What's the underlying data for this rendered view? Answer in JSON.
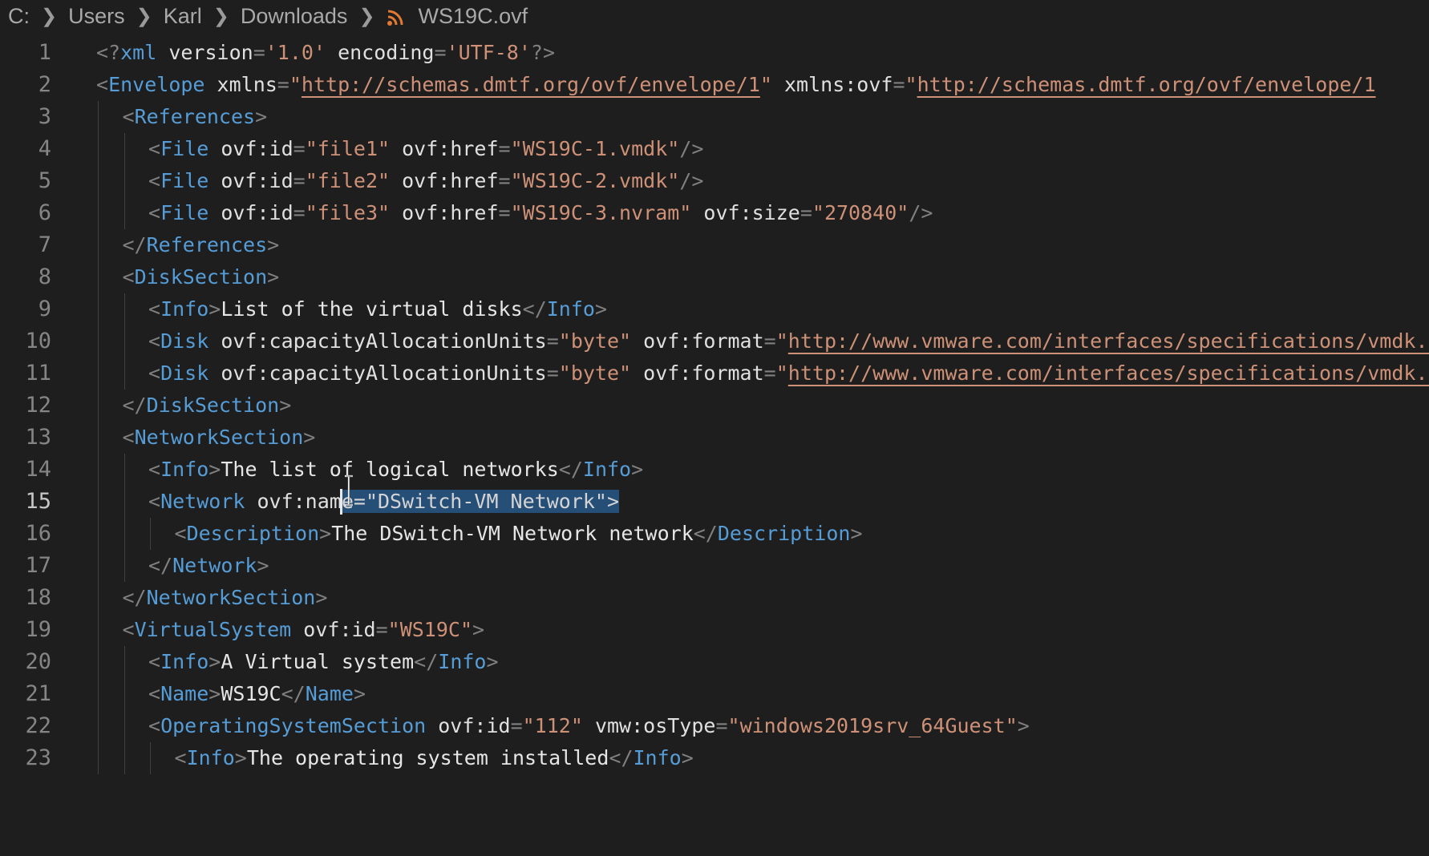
{
  "breadcrumb": {
    "items": [
      "C:",
      "Users",
      "Karl",
      "Downloads"
    ],
    "file": "WS19C.ovf",
    "file_icon": "rss-icon"
  },
  "editor": {
    "active_line": 15,
    "colors": {
      "background": "#1e1e1e",
      "tag": "#569cd6",
      "string": "#ce9178",
      "punctuation": "#808080",
      "selection": "#264f78"
    },
    "lines": [
      {
        "n": "1",
        "indent": 0,
        "tokens": [
          [
            "p",
            "<?"
          ],
          [
            "t",
            "xml"
          ],
          [
            "attr",
            " version"
          ],
          [
            "p",
            "="
          ],
          [
            "s",
            "'1.0'"
          ],
          [
            "attr",
            " encoding"
          ],
          [
            "p",
            "="
          ],
          [
            "s",
            "'UTF-8'"
          ],
          [
            "p",
            "?>"
          ]
        ]
      },
      {
        "n": "2",
        "indent": 0,
        "tokens": [
          [
            "p",
            "<"
          ],
          [
            "t",
            "Envelope"
          ],
          [
            "attr",
            " xmlns"
          ],
          [
            "p",
            "="
          ],
          [
            "s",
            "\""
          ],
          [
            "u",
            "http://schemas.dmtf.org/ovf/envelope/1"
          ],
          [
            "s",
            "\""
          ],
          [
            "attr",
            " xmlns:ovf"
          ],
          [
            "p",
            "="
          ],
          [
            "s",
            "\""
          ],
          [
            "u",
            "http://schemas.dmtf.org/ovf/envelope/1"
          ]
        ]
      },
      {
        "n": "3",
        "indent": 1,
        "tokens": [
          [
            "p",
            "<"
          ],
          [
            "t",
            "References"
          ],
          [
            "p",
            ">"
          ]
        ]
      },
      {
        "n": "4",
        "indent": 2,
        "tokens": [
          [
            "p",
            "<"
          ],
          [
            "t",
            "File"
          ],
          [
            "attr",
            " ovf:id"
          ],
          [
            "p",
            "="
          ],
          [
            "s",
            "\"file1\""
          ],
          [
            "attr",
            " ovf:href"
          ],
          [
            "p",
            "="
          ],
          [
            "s",
            "\"WS19C-1.vmdk\""
          ],
          [
            "p",
            "/>"
          ]
        ]
      },
      {
        "n": "5",
        "indent": 2,
        "tokens": [
          [
            "p",
            "<"
          ],
          [
            "t",
            "File"
          ],
          [
            "attr",
            " ovf:id"
          ],
          [
            "p",
            "="
          ],
          [
            "s",
            "\"file2\""
          ],
          [
            "attr",
            " ovf:href"
          ],
          [
            "p",
            "="
          ],
          [
            "s",
            "\"WS19C-2.vmdk\""
          ],
          [
            "p",
            "/>"
          ]
        ]
      },
      {
        "n": "6",
        "indent": 2,
        "tokens": [
          [
            "p",
            "<"
          ],
          [
            "t",
            "File"
          ],
          [
            "attr",
            " ovf:id"
          ],
          [
            "p",
            "="
          ],
          [
            "s",
            "\"file3\""
          ],
          [
            "attr",
            " ovf:href"
          ],
          [
            "p",
            "="
          ],
          [
            "s",
            "\"WS19C-3.nvram\""
          ],
          [
            "attr",
            " ovf:size"
          ],
          [
            "p",
            "="
          ],
          [
            "s",
            "\"270840\""
          ],
          [
            "p",
            "/>"
          ]
        ]
      },
      {
        "n": "7",
        "indent": 1,
        "tokens": [
          [
            "p",
            "</"
          ],
          [
            "t",
            "References"
          ],
          [
            "p",
            ">"
          ]
        ]
      },
      {
        "n": "8",
        "indent": 1,
        "tokens": [
          [
            "p",
            "<"
          ],
          [
            "t",
            "DiskSection"
          ],
          [
            "p",
            ">"
          ]
        ]
      },
      {
        "n": "9",
        "indent": 2,
        "tokens": [
          [
            "p",
            "<"
          ],
          [
            "t",
            "Info"
          ],
          [
            "p",
            ">"
          ],
          [
            "txt",
            "List of the virtual disks"
          ],
          [
            "p",
            "</"
          ],
          [
            "t",
            "Info"
          ],
          [
            "p",
            ">"
          ]
        ]
      },
      {
        "n": "10",
        "indent": 2,
        "tokens": [
          [
            "p",
            "<"
          ],
          [
            "t",
            "Disk"
          ],
          [
            "attr",
            " ovf:capacityAllocationUnits"
          ],
          [
            "p",
            "="
          ],
          [
            "s",
            "\"byte\""
          ],
          [
            "attr",
            " ovf:format"
          ],
          [
            "p",
            "="
          ],
          [
            "s",
            "\""
          ],
          [
            "u",
            "http://www.vmware.com/interfaces/specifications/vmdk.html"
          ]
        ]
      },
      {
        "n": "11",
        "indent": 2,
        "tokens": [
          [
            "p",
            "<"
          ],
          [
            "t",
            "Disk"
          ],
          [
            "attr",
            " ovf:capacityAllocationUnits"
          ],
          [
            "p",
            "="
          ],
          [
            "s",
            "\"byte\""
          ],
          [
            "attr",
            " ovf:format"
          ],
          [
            "p",
            "="
          ],
          [
            "s",
            "\""
          ],
          [
            "u",
            "http://www.vmware.com/interfaces/specifications/vmdk.html"
          ]
        ]
      },
      {
        "n": "12",
        "indent": 1,
        "tokens": [
          [
            "p",
            "</"
          ],
          [
            "t",
            "DiskSection"
          ],
          [
            "p",
            ">"
          ]
        ]
      },
      {
        "n": "13",
        "indent": 1,
        "tokens": [
          [
            "p",
            "<"
          ],
          [
            "t",
            "NetworkSection"
          ],
          [
            "p",
            ">"
          ]
        ]
      },
      {
        "n": "14",
        "indent": 2,
        "tokens": [
          [
            "p",
            "<"
          ],
          [
            "t",
            "Info"
          ],
          [
            "p",
            ">"
          ],
          [
            "txt",
            "The list of logical networks"
          ],
          [
            "p",
            "</"
          ],
          [
            "t",
            "Info"
          ],
          [
            "p",
            ">"
          ]
        ]
      },
      {
        "n": "15",
        "indent": 2,
        "tokens": [
          [
            "p",
            "<"
          ],
          [
            "t",
            "Network"
          ],
          [
            "attr",
            " ovf:nam"
          ],
          [
            "sel",
            "e=\"DSwitch-VM Network\">"
          ]
        ]
      },
      {
        "n": "16",
        "indent": 3,
        "tokens": [
          [
            "p",
            "<"
          ],
          [
            "t",
            "Description"
          ],
          [
            "p",
            ">"
          ],
          [
            "txt",
            "The DSwitch-VM Network network"
          ],
          [
            "p",
            "</"
          ],
          [
            "t",
            "Description"
          ],
          [
            "p",
            ">"
          ]
        ]
      },
      {
        "n": "17",
        "indent": 2,
        "tokens": [
          [
            "p",
            "</"
          ],
          [
            "t",
            "Network"
          ],
          [
            "p",
            ">"
          ]
        ]
      },
      {
        "n": "18",
        "indent": 1,
        "tokens": [
          [
            "p",
            "</"
          ],
          [
            "t",
            "NetworkSection"
          ],
          [
            "p",
            ">"
          ]
        ]
      },
      {
        "n": "19",
        "indent": 1,
        "tokens": [
          [
            "p",
            "<"
          ],
          [
            "t",
            "VirtualSystem"
          ],
          [
            "attr",
            " ovf:id"
          ],
          [
            "p",
            "="
          ],
          [
            "s",
            "\"WS19C\""
          ],
          [
            "p",
            ">"
          ]
        ]
      },
      {
        "n": "20",
        "indent": 2,
        "tokens": [
          [
            "p",
            "<"
          ],
          [
            "t",
            "Info"
          ],
          [
            "p",
            ">"
          ],
          [
            "txt",
            "A Virtual system"
          ],
          [
            "p",
            "</"
          ],
          [
            "t",
            "Info"
          ],
          [
            "p",
            ">"
          ]
        ]
      },
      {
        "n": "21",
        "indent": 2,
        "tokens": [
          [
            "p",
            "<"
          ],
          [
            "t",
            "Name"
          ],
          [
            "p",
            ">"
          ],
          [
            "txt",
            "WS19C"
          ],
          [
            "p",
            "</"
          ],
          [
            "t",
            "Name"
          ],
          [
            "p",
            ">"
          ]
        ]
      },
      {
        "n": "22",
        "indent": 2,
        "tokens": [
          [
            "p",
            "<"
          ],
          [
            "t",
            "OperatingSystemSection"
          ],
          [
            "attr",
            " ovf:id"
          ],
          [
            "p",
            "="
          ],
          [
            "s",
            "\"112\""
          ],
          [
            "attr",
            " vmw:osType"
          ],
          [
            "p",
            "="
          ],
          [
            "s",
            "\"windows2019srv_64Guest\""
          ],
          [
            "p",
            ">"
          ]
        ]
      },
      {
        "n": "23",
        "indent": 3,
        "tokens": [
          [
            "p",
            "<"
          ],
          [
            "t",
            "Info"
          ],
          [
            "p",
            ">"
          ],
          [
            "txt",
            "The operating system installed"
          ],
          [
            "p",
            "</"
          ],
          [
            "t",
            "Info"
          ],
          [
            "p",
            ">"
          ]
        ]
      }
    ]
  }
}
